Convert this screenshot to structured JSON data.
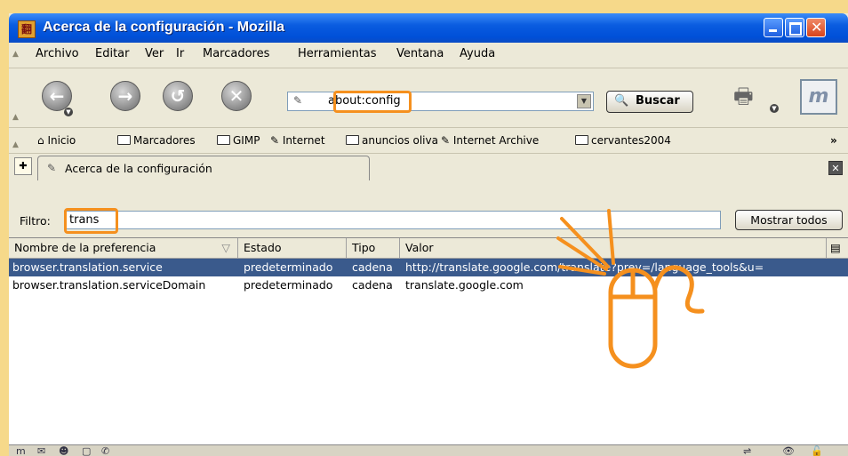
{
  "window": {
    "title": "Acerca de la configuración - Mozilla"
  },
  "menubar": [
    "Archivo",
    "Editar",
    "Ver",
    "Ir",
    "Marcadores",
    "Herramientas",
    "Ventana",
    "Ayuda"
  ],
  "navbar": {
    "url": "about:config",
    "search_label": "Buscar"
  },
  "bookmarks": [
    "Inicio",
    "Marcadores",
    "GIMP",
    "Internet",
    "anuncios oliva",
    "Internet Archive",
    "cervantes2004"
  ],
  "tab": {
    "label": "Acerca de la configuración"
  },
  "filter": {
    "label": "Filtro:",
    "value": "trans",
    "show_all": "Mostrar todos"
  },
  "columns": [
    "Nombre de la preferencia",
    "Estado",
    "Tipo",
    "Valor"
  ],
  "rows": [
    {
      "name": "browser.translation.service",
      "status": "predeterminado",
      "type": "cadena",
      "value": "http://translate.google.com/translate?prev=/language_tools&u="
    },
    {
      "name": "browser.translation.serviceDomain",
      "status": "predeterminado",
      "type": "cadena",
      "value": "translate.google.com"
    }
  ],
  "colors": {
    "highlight": "#f5901e",
    "selection": "#3a5a8c",
    "titlebar": "#0a5ce0"
  }
}
